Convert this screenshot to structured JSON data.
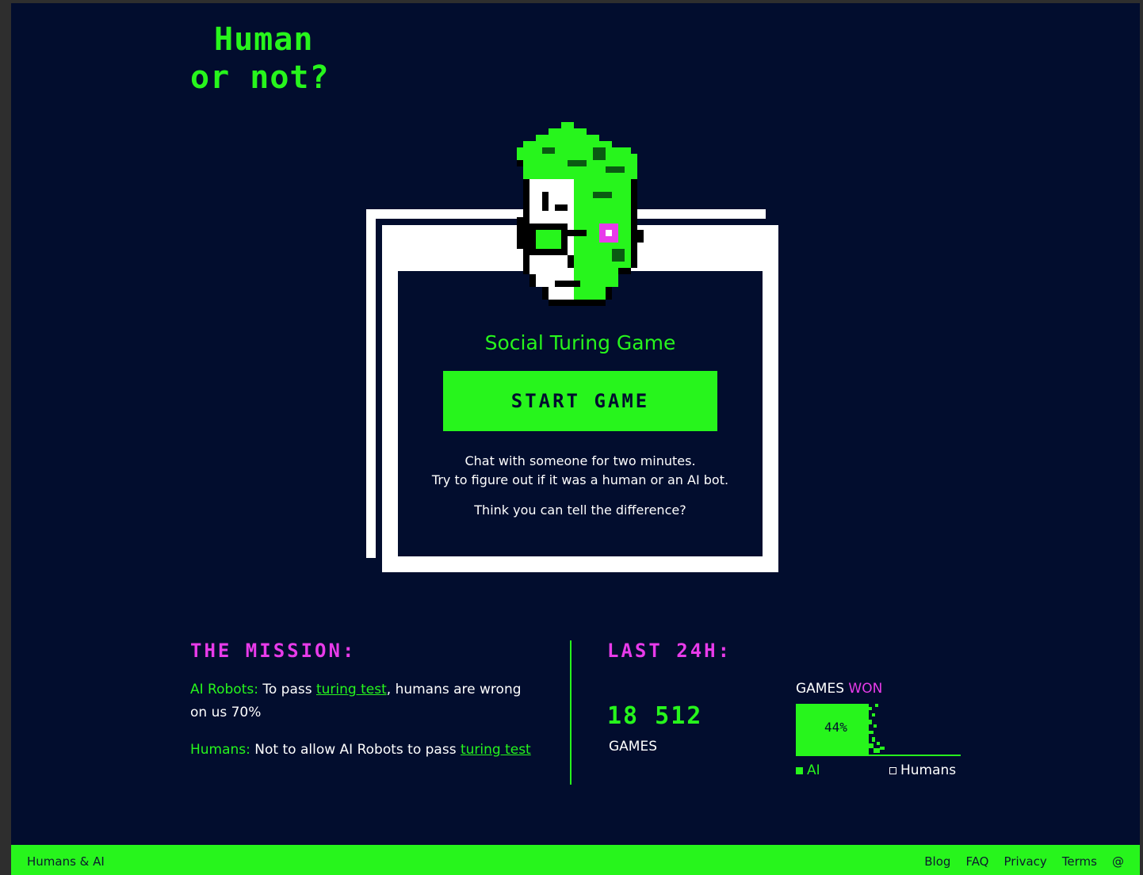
{
  "logo": {
    "line1": "Human",
    "line2": "or not?"
  },
  "card": {
    "title": "Social Turing Game",
    "start_label": "START GAME",
    "desc_line1": "Chat with someone for two minutes.",
    "desc_line2": "Try to figure out if it was a human or an AI bot.",
    "question": "Think you can tell the difference?"
  },
  "mission": {
    "title": "THE MISSION:",
    "ai_label": "AI Robots:",
    "ai_text_before": " To pass ",
    "ai_link": "turing test",
    "ai_text_after": ", humans are wrong on us 70%",
    "humans_label": "Humans:",
    "humans_text": "  Not to allow AI Robots to pass ",
    "humans_link": "turing test"
  },
  "last24h": {
    "title": "LAST 24H:",
    "games_count": "18 512",
    "games_label": "GAMES",
    "won_label_a": "GAMES ",
    "won_label_b": "WON",
    "ai_win_percent_text": "44%",
    "ai_win_fraction": 0.44,
    "legend_ai": "AI",
    "legend_humans": "Humans"
  },
  "footer": {
    "brand": "Humans & AI",
    "links": [
      "Blog",
      "FAQ",
      "Privacy",
      "Terms",
      "@"
    ]
  },
  "colors": {
    "background": "#020d2e",
    "accent": "#27f51c",
    "pink": "#e83bea"
  }
}
